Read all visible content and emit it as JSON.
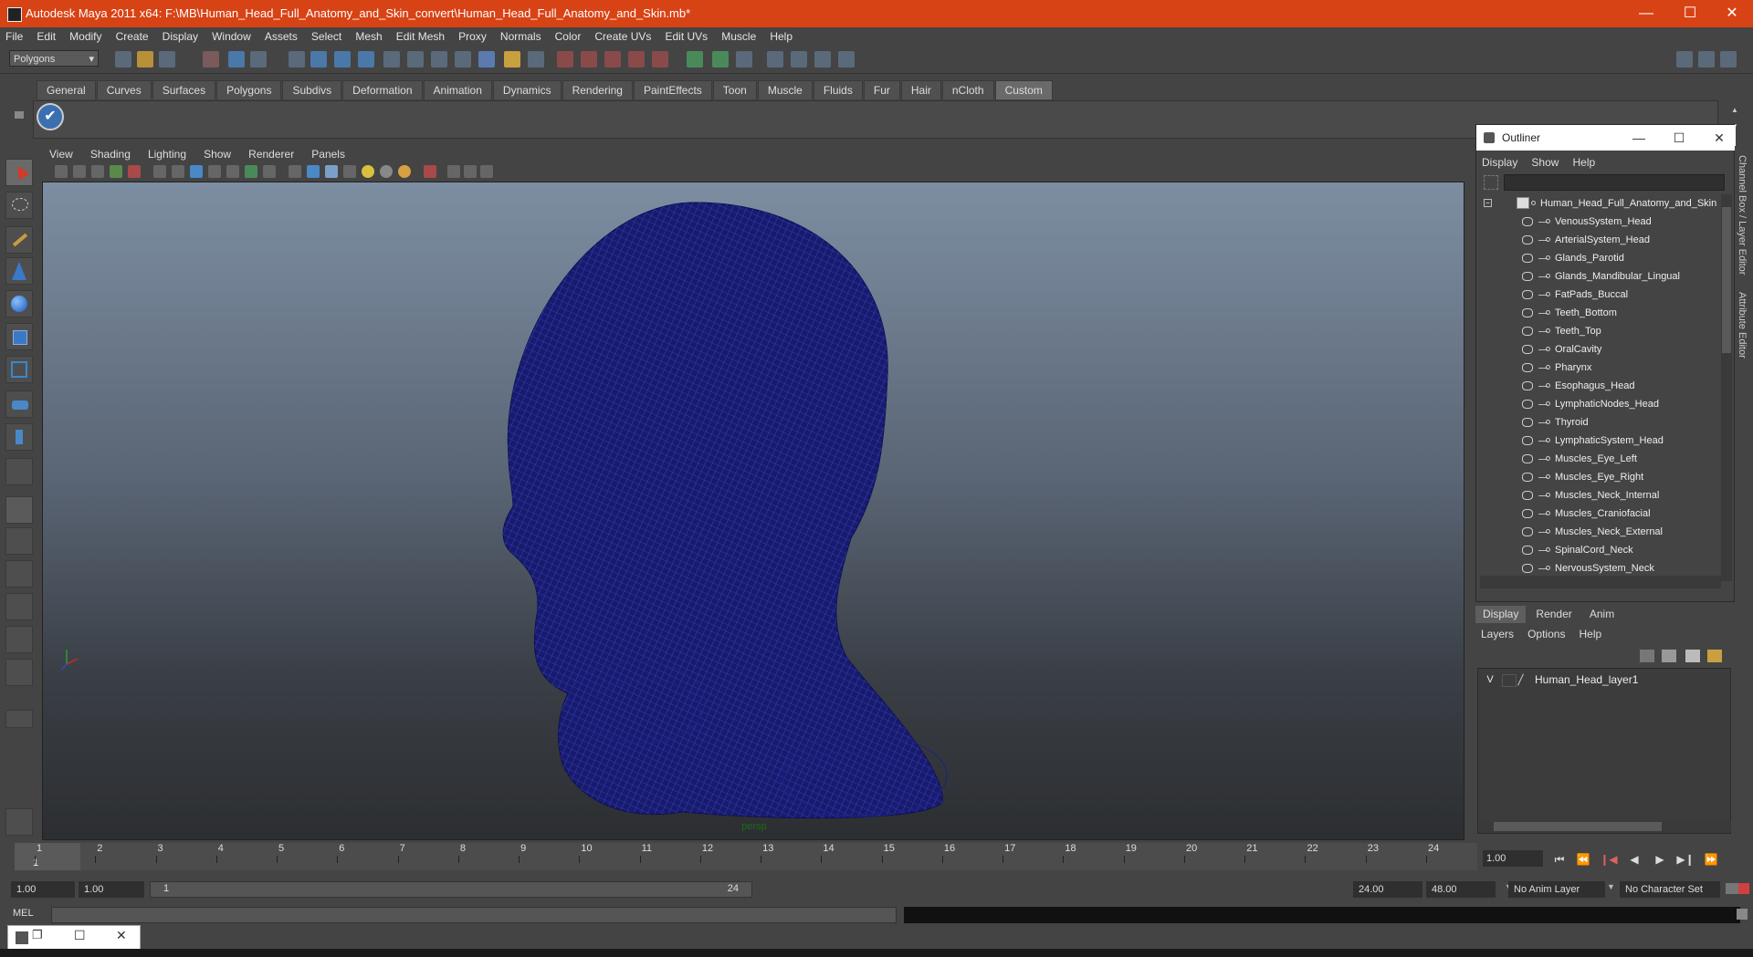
{
  "window": {
    "title": "Autodesk Maya 2011 x64: F:\\MB\\Human_Head_Full_Anatomy_and_Skin_convert\\Human_Head_Full_Anatomy_and_Skin.mb*",
    "minimize": "—",
    "maximize": "☐",
    "close": "✕"
  },
  "menubar": [
    "File",
    "Edit",
    "Modify",
    "Create",
    "Display",
    "Window",
    "Assets",
    "Select",
    "Mesh",
    "Edit Mesh",
    "Proxy",
    "Normals",
    "Color",
    "Create UVs",
    "Edit UVs",
    "Muscle",
    "Help"
  ],
  "statusline": {
    "mode": "Polygons"
  },
  "shelf": {
    "tabs": [
      "General",
      "Curves",
      "Surfaces",
      "Polygons",
      "Subdivs",
      "Deformation",
      "Animation",
      "Dynamics",
      "Rendering",
      "PaintEffects",
      "Toon",
      "Muscle",
      "Fluids",
      "Fur",
      "Hair",
      "nCloth",
      "Custom"
    ],
    "active_tab": "Custom",
    "button_glyph": "✔"
  },
  "panel": {
    "menu": [
      "View",
      "Shading",
      "Lighting",
      "Show",
      "Renderer",
      "Panels"
    ],
    "camera_label": "persp"
  },
  "outliner": {
    "title": "Outliner",
    "menu": [
      "Display",
      "Show",
      "Help"
    ],
    "root": "Human_Head_Full_Anatomy_and_Skin",
    "items": [
      "VenousSystem_Head",
      "ArterialSystem_Head",
      "Glands_Parotid",
      "Glands_Mandibular_Lingual",
      "FatPads_Buccal",
      "Teeth_Bottom",
      "Teeth_Top",
      "OralCavity",
      "Pharynx",
      "Esophagus_Head",
      "LymphaticNodes_Head",
      "Thyroid",
      "LymphaticSystem_Head",
      "Muscles_Eye_Left",
      "Muscles_Eye_Right",
      "Muscles_Neck_Internal",
      "Muscles_Craniofacial",
      "Muscles_Neck_External",
      "SpinalCord_Neck",
      "NervousSystem_Neck"
    ]
  },
  "side_tabs": [
    "Channel Box / Layer Editor",
    "Attribute Editor"
  ],
  "layer_editor": {
    "tabs": [
      "Display",
      "Render",
      "Anim"
    ],
    "active_tab": "Display",
    "menu": [
      "Layers",
      "Options",
      "Help"
    ],
    "layer": {
      "visible": "V",
      "name": "Human_Head_layer1"
    }
  },
  "timeslider": {
    "ticks": [
      "1",
      "2",
      "3",
      "4",
      "5",
      "6",
      "7",
      "8",
      "9",
      "10",
      "11",
      "12",
      "13",
      "14",
      "15",
      "16",
      "17",
      "18",
      "19",
      "20",
      "21",
      "22",
      "23",
      "24"
    ],
    "current_marker": "1",
    "current_frame": "1.00"
  },
  "playback": [
    "⏮",
    "⏪",
    "❙◀",
    "◀",
    "▶",
    "▶❙",
    "⏩"
  ],
  "range": {
    "start_a": "1.00",
    "start_b": "1.00",
    "slider_start": "1",
    "slider_end": "24",
    "end_a": "24.00",
    "end_b": "48.00",
    "anim_layer": "No Anim Layer",
    "char_set": "No Character Set"
  },
  "command": {
    "label": "MEL"
  },
  "colors": {
    "titlebar": "#d84315",
    "wire": "#1a1a78",
    "accent": "#3a70b0"
  }
}
